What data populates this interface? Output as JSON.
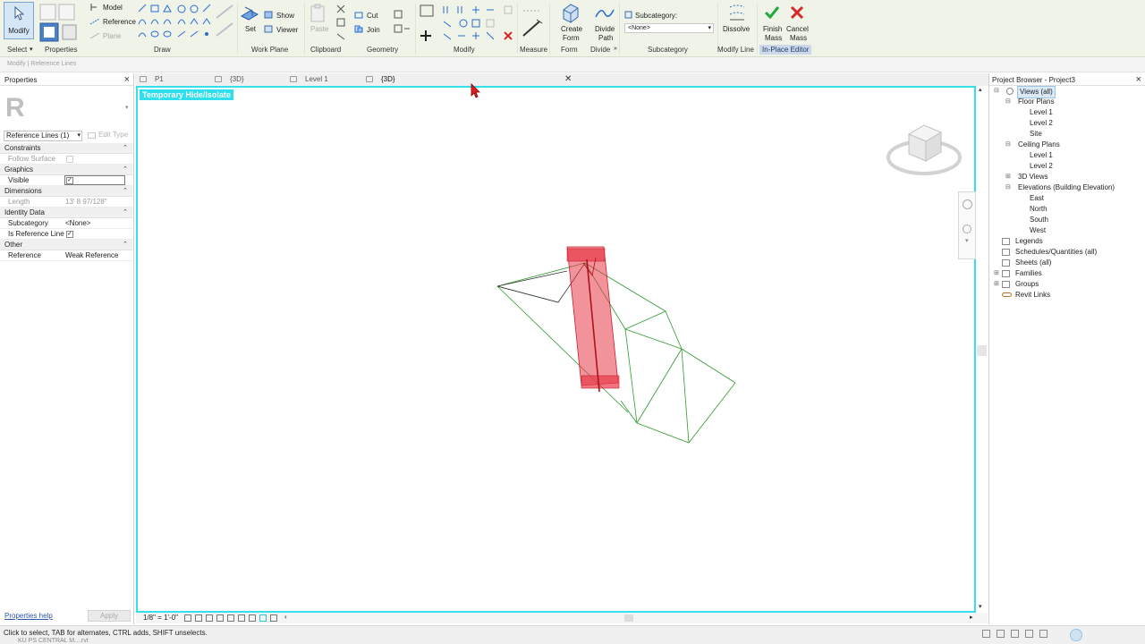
{
  "ribbon": {
    "modify_label": "Modify",
    "draw_model": "Model",
    "draw_reference": "Reference",
    "draw_plane": "Plane",
    "workplane_set": "Set",
    "workplane_show": "Show",
    "workplane_viewer": "Viewer",
    "clipboard_paste": "Paste",
    "clipboard_cut": "Cut",
    "geometry_join": "Join",
    "form_create_line1": "Create",
    "form_create_line2": "Form",
    "divide_path_line1": "Divide",
    "divide_path_line2": "Path",
    "subcategory_label": "Subcategory:",
    "subcategory_value": "<None>",
    "dissolve": "Dissolve",
    "finish_line1": "Finish",
    "finish_line2": "Mass",
    "cancel_line1": "Cancel",
    "cancel_line2": "Mass",
    "panels": {
      "select": "Select",
      "properties": "Properties",
      "draw": "Draw",
      "work_plane": "Work Plane",
      "clipboard": "Clipboard",
      "geometry": "Geometry",
      "modify": "Modify",
      "measure": "Measure",
      "form": "Form",
      "divide": "Divide",
      "subcategory": "Subcategory",
      "modify_line": "Modify Line",
      "in_place_editor": "In-Place Editor"
    }
  },
  "context_bar": "Modify | Reference Lines",
  "properties": {
    "title": "Properties",
    "type_selector": "Reference Lines (1)",
    "edit_type": "Edit Type",
    "categories": {
      "constraints": "Constraints",
      "graphics": "Graphics",
      "dimensions": "Dimensions",
      "identity": "Identity Data",
      "other": "Other"
    },
    "rows": {
      "follow_surface": "Follow Surface",
      "visible": "Visible",
      "length": "Length",
      "length_value": "13' 8 97/128\"",
      "subcategory": "Subcategory",
      "subcategory_value": "<None>",
      "is_reference_line": "Is Reference Line",
      "reference": "Reference",
      "reference_value": "Weak Reference"
    },
    "help_link": "Properties help",
    "apply": "Apply"
  },
  "tabs": [
    {
      "label": "P1"
    },
    {
      "label": "{3D}"
    },
    {
      "label": "Level 1"
    },
    {
      "label": "{3D}"
    }
  ],
  "canvas": {
    "badge": "Temporary Hide/Isolate",
    "scale": "1/8\" = 1'-0\""
  },
  "browser": {
    "title": "Project Browser - Project3",
    "items": [
      {
        "label": "Views (all)"
      },
      {
        "label": "Floor Plans"
      },
      {
        "label": "Level 1"
      },
      {
        "label": "Level 2"
      },
      {
        "label": "Site"
      },
      {
        "label": "Ceiling Plans"
      },
      {
        "label": "Level 1"
      },
      {
        "label": "Level 2"
      },
      {
        "label": "3D Views"
      },
      {
        "label": "Elevations (Building Elevation)"
      },
      {
        "label": "East"
      },
      {
        "label": "North"
      },
      {
        "label": "South"
      },
      {
        "label": "West"
      },
      {
        "label": "Legends"
      },
      {
        "label": "Schedules/Quantities (all)"
      },
      {
        "label": "Sheets (all)"
      },
      {
        "label": "Families"
      },
      {
        "label": "Groups"
      },
      {
        "label": "Revit Links"
      }
    ]
  },
  "status": {
    "text": "Click to select, TAB for alternates, CTRL adds, SHIFT unselects.",
    "taskbar": "KU PS CENTRAL M....rvt"
  },
  "colors": {
    "accent_cyan": "#33e0ec",
    "selection_red": "#e83a4a",
    "mesh_green": "#2e9a2e",
    "finish_green": "#1faa3a",
    "cancel_red": "#d42a2a"
  }
}
